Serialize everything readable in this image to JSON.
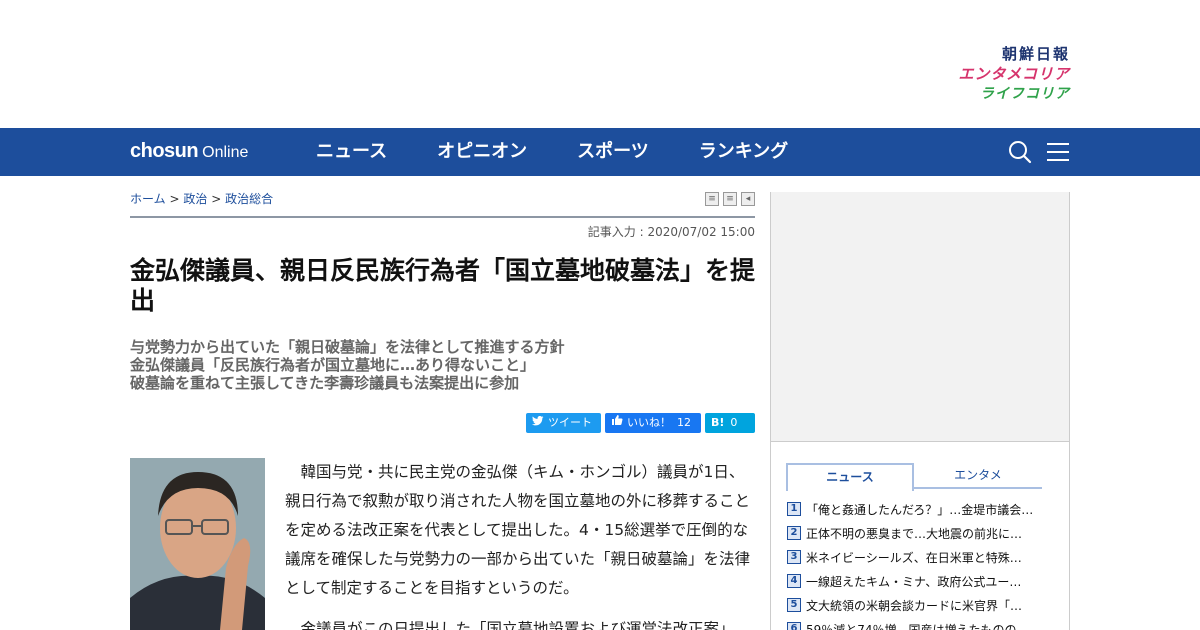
{
  "brand_links": {
    "chosun_ilbo": "朝鮮日報",
    "entame_korea": "エンタメコリア",
    "life_korea": "ライフコリア"
  },
  "logo": {
    "bold": "chosun",
    "light": "Online"
  },
  "nav": [
    {
      "label": "ニュース"
    },
    {
      "label": "オピニオン"
    },
    {
      "label": "スポーツ"
    },
    {
      "label": "ランキング"
    }
  ],
  "breadcrumb": {
    "home": "ホーム",
    "sep": ">",
    "section": "政治",
    "subsection": "政治総合"
  },
  "date_line": "記事入力 : 2020/07/02 15:00",
  "headline": "金弘傑議員、親日反民族行為者「国立墓地破墓法」を提出",
  "subheads": [
    "与党勢力から出ていた「親日破墓論」を法律として推進する方針",
    "金弘傑議員「反民族行為者が国立墓地に…あり得ないこと」",
    "破墓論を重ねて主張してきた李壽珍議員も法案提出に参加"
  ],
  "share": {
    "tweet": "ツイート",
    "like": "いいね！",
    "like_count": "12",
    "hatena": "B!",
    "hatena_count": "0"
  },
  "article": [
    "韓国与党・共に民主党の金弘傑（キム・ホンゴル）議員が1日、親日行為で叙勲が取り消された人物を国立墓地の外に移葬することを定める法改正案を代表として提出した。4・15総選挙で圧倒的な議席を確保した与党勢力の一部から出ていた「親日破墓論」を法律として制定することを目指すというのだ。",
    "金議員がこの日提出した「国立墓地設置および運営法改正案」"
  ],
  "sidebar": {
    "tabs": [
      "ニュース",
      "エンタメ"
    ],
    "ranking": [
      {
        "num": "1",
        "title": "「俺と姦通したんだろ？」…金堤市議会…"
      },
      {
        "num": "2",
        "title": "正体不明の悪臭まで…大地震の前兆に…"
      },
      {
        "num": "3",
        "title": "米ネイビーシールズ、在日米軍と特殊…"
      },
      {
        "num": "4",
        "title": "一線超えたキム・ミナ、政府公式ユー…"
      },
      {
        "num": "5",
        "title": "文大統領の米朝会談カードに米官界「…"
      },
      {
        "num": "6",
        "title": "59％減と74％増…国産は増えたものの…"
      }
    ]
  },
  "colors": {
    "nav_bg": "#1d4e9c",
    "twitter": "#1d9bf0",
    "facebook": "#1877f2",
    "hatena": "#00a4de"
  }
}
